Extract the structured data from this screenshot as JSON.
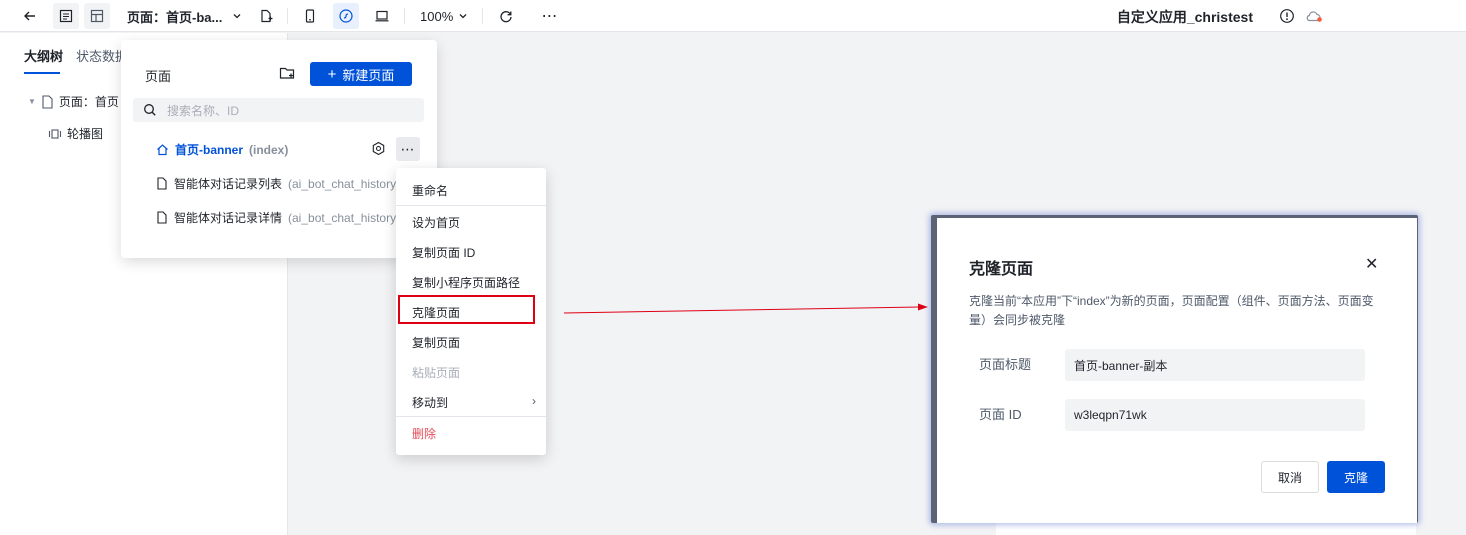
{
  "toolbar": {
    "page_selector": "页面：首页-ba...",
    "zoom": "100%",
    "app_title": "自定义应用_christest"
  },
  "left_panel": {
    "tabs": [
      "大纲树",
      "状态数据"
    ],
    "tree": [
      {
        "label": "页面：首页"
      },
      {
        "label": "轮播图"
      }
    ]
  },
  "page_popover": {
    "title": "页面",
    "new_page_label": "新建页面",
    "search_placeholder": "搜索名称、ID",
    "pages": [
      {
        "name": "首页-banner",
        "id": "(index)"
      },
      {
        "name": "智能体对话记录列表",
        "id": "(ai_bot_chat_history_"
      },
      {
        "name": "智能体对话记录详情",
        "id": "(ai_bot_chat_history_"
      }
    ]
  },
  "context_menu": {
    "items": [
      "重命名",
      "设为首页",
      "复制页面 ID",
      "复制小程序页面路径",
      "克隆页面",
      "复制页面",
      "粘贴页面",
      "移动到",
      "删除"
    ],
    "highlighted": "克隆页面"
  },
  "dialog": {
    "title": "克隆页面",
    "description": "克隆当前“本应用”下“index”为新的页面，页面配置（组件、页面方法、页面变量）会同步被克隆",
    "title_label": "页面标题",
    "title_value": "首页-banner-副本",
    "id_label": "页面 ID",
    "id_value": "w3leqpn71wk",
    "cancel_label": "取消",
    "confirm_label": "克隆"
  },
  "colors": {
    "primary": "#0052d9",
    "highlight_border": "#e00015",
    "danger": "#e34d59"
  }
}
